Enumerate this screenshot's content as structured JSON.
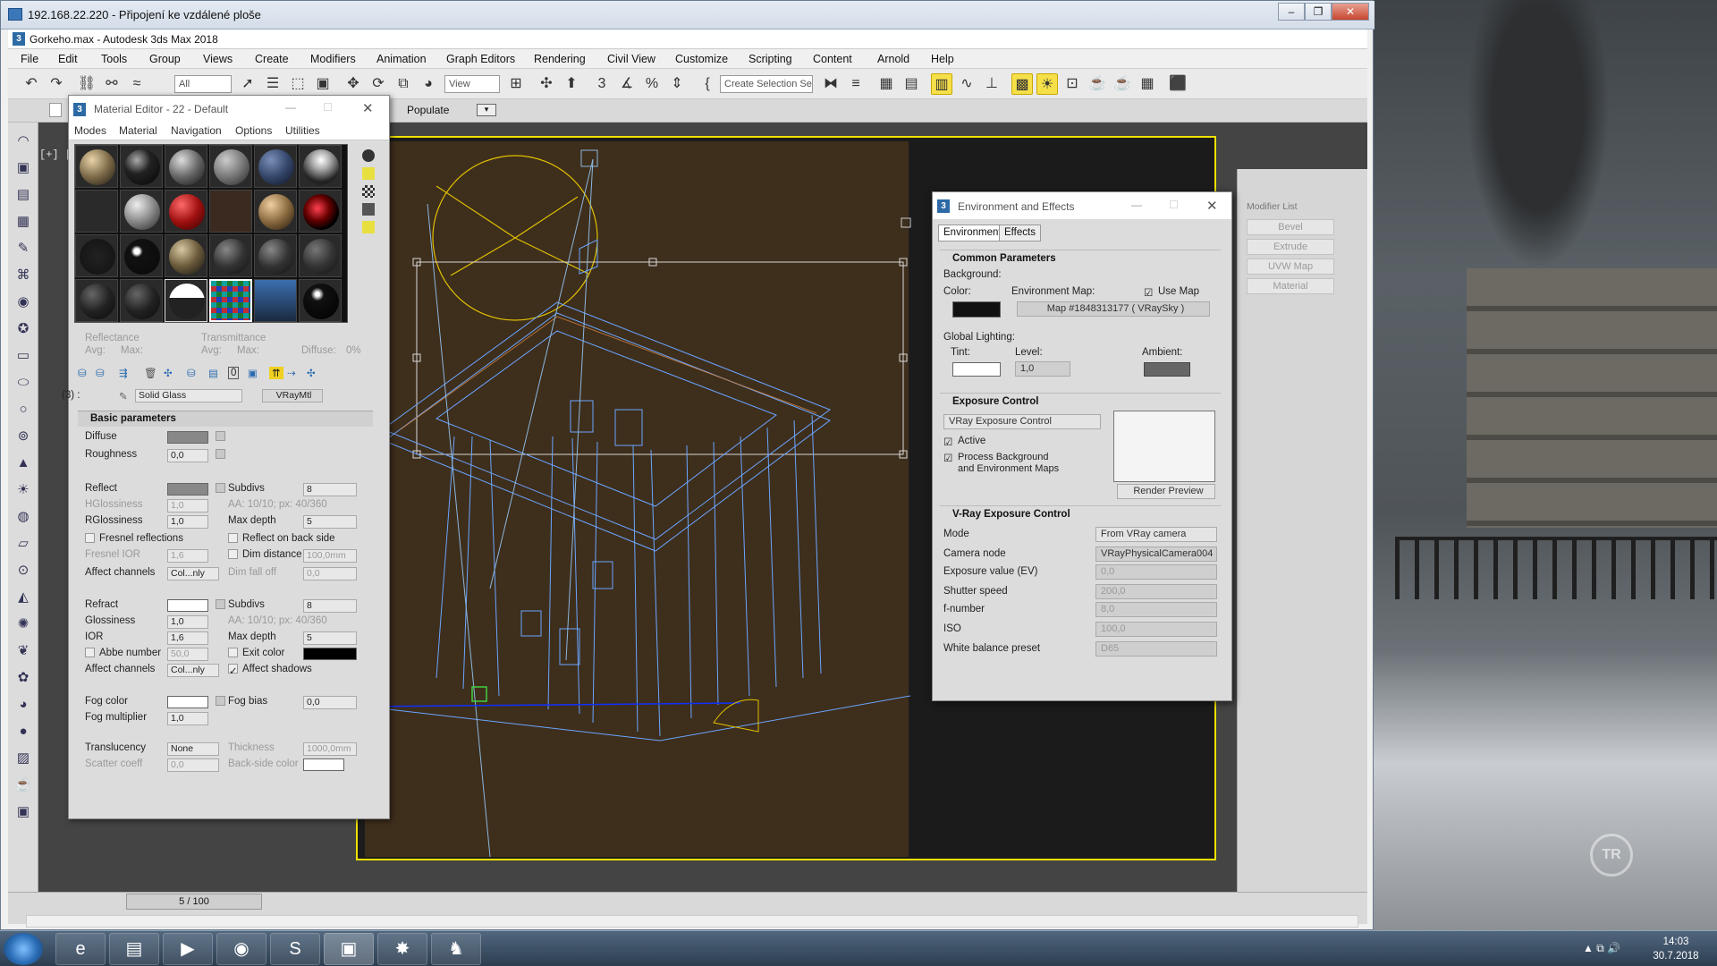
{
  "rdp": {
    "title": "192.168.22.220 - Připojení ke vzdálené ploše"
  },
  "max": {
    "title": "Gorkeho.max - Autodesk 3ds Max 2018",
    "menu": [
      "File",
      "Edit",
      "Tools",
      "Group",
      "Views",
      "Create",
      "Modifiers",
      "Animation",
      "Graph Editors",
      "Rendering",
      "Civil View",
      "Customize",
      "Scripting",
      "Content",
      "Arnold",
      "Help"
    ],
    "toolbar": {
      "selection_filter": "All",
      "ref_coord": "View",
      "named_selection": "Create Selection Se",
      "populate": "Populate"
    },
    "viewport_label": "[+] [",
    "modifier_list_label": "Modifier List",
    "modifier_buttons": [
      "Bevel",
      "Extrude",
      "UVW Map",
      "Material"
    ],
    "timeslider": "5 / 100"
  },
  "material_editor": {
    "title": "Material Editor - 22 - Default",
    "menu": [
      "Modes",
      "Material",
      "Navigation",
      "Options",
      "Utilities"
    ],
    "reflectance": "Reflectance",
    "transmittance": "Transmittance",
    "avg": "Avg:",
    "max": "Max:",
    "diffuse_pct": "Diffuse:",
    "diffuse_pct_val": "0%",
    "slot_index": "(3) :",
    "material_name": "Solid Glass",
    "material_type": "VRayMtl",
    "basic_params": "Basic parameters",
    "diffuse": "Diffuse",
    "roughness": "Roughness",
    "roughness_val": "0,0",
    "reflect": "Reflect",
    "subdivs": "Subdivs",
    "subdivs_val": "8",
    "hglossiness": "HGlossiness",
    "hgloss_val": "1,0",
    "aa_note": "AA: 10/10; px: 40/360",
    "rglossiness": "RGlossiness",
    "rgloss_val": "1,0",
    "max_depth": "Max depth",
    "max_depth_val": "5",
    "fresnel": "Fresnel reflections",
    "reflect_back": "Reflect on back side",
    "fresnel_ior": "Fresnel IOR",
    "fresnel_ior_val": "1,6",
    "dim_distance": "Dim distance",
    "dim_distance_val": "100,0mm",
    "affect_channels": "Affect channels",
    "affect_channels_val": "Col...nly",
    "dim_falloff": "Dim fall off",
    "dim_falloff_val": "0,0",
    "refract": "Refract",
    "refract_subdivs_val": "8",
    "glossiness": "Glossiness",
    "gloss_val": "1,0",
    "ior": "IOR",
    "ior_val": "1,6",
    "refract_max_depth_val": "5",
    "abbe": "Abbe number",
    "abbe_val": "50,0",
    "exit_color": "Exit color",
    "affect_channels2_val": "Col...nly",
    "affect_shadows": "Affect shadows",
    "fog_color": "Fog color",
    "fog_bias": "Fog bias",
    "fog_bias_val": "0,0",
    "fog_multiplier": "Fog multiplier",
    "fog_mult_val": "1,0",
    "translucency": "Translucency",
    "translucency_val": "None",
    "thickness": "Thickness",
    "thickness_val": "1000,0mm",
    "scatter_coeff": "Scatter coeff",
    "scatter_val": "0,0",
    "backside_color": "Back-side color"
  },
  "env": {
    "title": "Environment and Effects",
    "tabs": [
      "Environment",
      "Effects"
    ],
    "common_params": "Common Parameters",
    "background": "Background:",
    "color": "Color:",
    "env_map": "Environment Map:",
    "use_map": "Use Map",
    "map_name": "Map #1848313177  ( VRaySky )",
    "global_lighting": "Global Lighting:",
    "tint": "Tint:",
    "level": "Level:",
    "level_val": "1,0",
    "ambient": "Ambient:",
    "exposure_control": "Exposure Control",
    "exposure_type": "VRay Exposure Control",
    "active": "Active",
    "process_bg": "Process Background",
    "process_bg2": "and Environment Maps",
    "render_preview": "Render Preview",
    "vray_exposure": "V-Ray Exposure Control",
    "mode": "Mode",
    "mode_val": "From VRay camera",
    "camera_node": "Camera node",
    "camera_node_val": "VRayPhysicalCamera004",
    "ev": "Exposure value (EV)",
    "ev_val": "0,0",
    "shutter": "Shutter speed",
    "shutter_val": "200,0",
    "fnumber": "f-number",
    "fnumber_val": "8,0",
    "iso": "ISO",
    "iso_val": "100,0",
    "wb": "White balance preset",
    "wb_val": "D65"
  },
  "taskbar": {
    "time": "14:03",
    "date": "30.7.2018"
  },
  "wallpaper_logo": "TR",
  "colors": {
    "selection": "#f0e000",
    "wire": "#6aa6ff",
    "viewport_bg": "#3e2e1c"
  }
}
